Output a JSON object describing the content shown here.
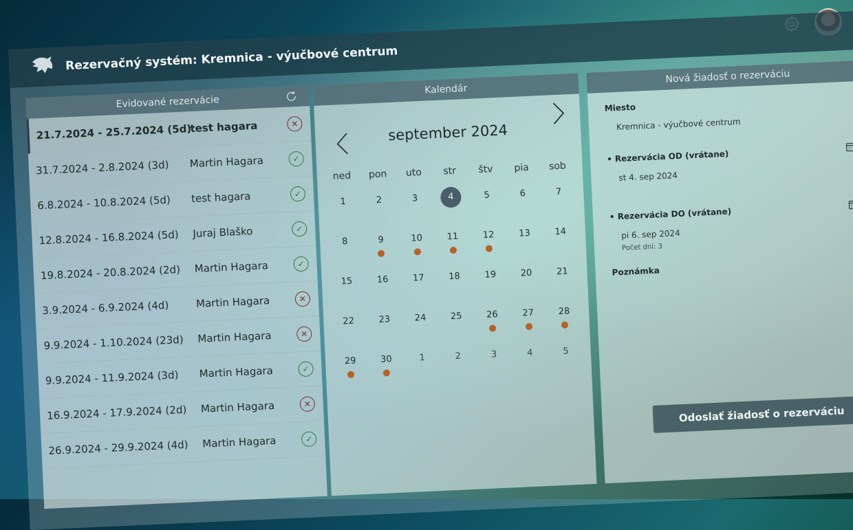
{
  "app": {
    "title": "Rezervačný systém: Kremnica - výučbové centrum"
  },
  "reservations": {
    "header": "Evidované rezervácie",
    "items": [
      {
        "dates": "21.7.2024 - 25.7.2024 (5d)",
        "name": "test hagara",
        "status": "cancelled",
        "active": true
      },
      {
        "dates": "31.7.2024 - 2.8.2024 (3d)",
        "name": "Martin  Hagara",
        "status": "approved"
      },
      {
        "dates": "6.8.2024 - 10.8.2024 (5d)",
        "name": "test hagara",
        "status": "approved"
      },
      {
        "dates": "12.8.2024 - 16.8.2024 (5d)",
        "name": "Juraj Blaško",
        "status": "approved"
      },
      {
        "dates": "19.8.2024 - 20.8.2024 (2d)",
        "name": "Martin  Hagara",
        "status": "approved"
      },
      {
        "dates": "3.9.2024 - 6.9.2024 (4d)",
        "name": "Martin  Hagara",
        "status": "cancelled"
      },
      {
        "dates": "9.9.2024 - 1.10.2024 (23d)",
        "name": "Martin  Hagara",
        "status": "cancelled"
      },
      {
        "dates": "9.9.2024 - 11.9.2024 (3d)",
        "name": "Martin  Hagara",
        "status": "approved"
      },
      {
        "dates": "16.9.2024 - 17.9.2024 (2d)",
        "name": "Martin  Hagara",
        "status": "cancelled"
      },
      {
        "dates": "26.9.2024 - 29.9.2024 (4d)",
        "name": "Martin  Hagara",
        "status": "approved"
      }
    ]
  },
  "calendar": {
    "header": "Kalendár",
    "month_label": "september 2024",
    "weekdays": [
      "ned",
      "pon",
      "uto",
      "str",
      "štv",
      "pia",
      "sob"
    ],
    "today": "4",
    "marker_color": "#b4622a",
    "days": [
      {
        "d": "1"
      },
      {
        "d": "2"
      },
      {
        "d": "3"
      },
      {
        "d": "4",
        "today": true
      },
      {
        "d": "5"
      },
      {
        "d": "6"
      },
      {
        "d": "7"
      },
      {
        "d": "8"
      },
      {
        "d": "9",
        "marked": true
      },
      {
        "d": "10",
        "marked": true
      },
      {
        "d": "11",
        "marked": true
      },
      {
        "d": "12",
        "marked": true
      },
      {
        "d": "13"
      },
      {
        "d": "14"
      },
      {
        "d": "15"
      },
      {
        "d": "16"
      },
      {
        "d": "17"
      },
      {
        "d": "18"
      },
      {
        "d": "19"
      },
      {
        "d": "20"
      },
      {
        "d": "21"
      },
      {
        "d": "22"
      },
      {
        "d": "23"
      },
      {
        "d": "24"
      },
      {
        "d": "25"
      },
      {
        "d": "26",
        "marked": true
      },
      {
        "d": "27",
        "marked": true
      },
      {
        "d": "28",
        "marked": true
      },
      {
        "d": "29",
        "marked": true
      },
      {
        "d": "30",
        "marked": true
      },
      {
        "d": "1",
        "other": true
      },
      {
        "d": "2",
        "other": true
      },
      {
        "d": "3",
        "other": true
      },
      {
        "d": "4",
        "other": true
      },
      {
        "d": "5",
        "other": true
      }
    ]
  },
  "form": {
    "header": "Nová žiadosť o rezerváciu",
    "place_label": "Miesto",
    "place_value": "Kremnica - výučbové centrum",
    "from_label": "Rezervácia OD (vrátane)",
    "from_value": "st 4. sep 2024",
    "to_label": "Rezervácia DO (vrátane)",
    "to_value": "pi 6. sep 2024",
    "days_count": "Počet dní: 3",
    "note_label": "Poznámka",
    "submit_label": "Odoslať žiadosť o rezerváciu"
  }
}
